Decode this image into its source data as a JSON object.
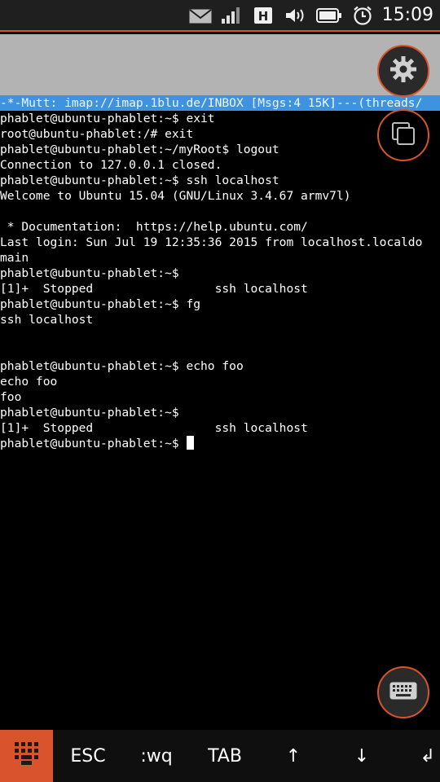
{
  "status_bar": {
    "time": "15:09",
    "icons": [
      "envelope-icon",
      "signal-icon",
      "hspa-icon",
      "volume-icon",
      "battery-icon",
      "alarm-icon"
    ],
    "network_label": "H"
  },
  "terminal": {
    "lines": [
      "-*-Mutt: imap://imap.1blu.de/INBOX [Msgs:4 15K]---(threads/",
      "phablet@ubuntu-phablet:~$ exit",
      "root@ubuntu-phablet:/# exit",
      "phablet@ubuntu-phablet:~/myRoot$ logout",
      "Connection to 127.0.0.1 closed.",
      "phablet@ubuntu-phablet:~$ ssh localhost",
      "Welcome to Ubuntu 15.04 (GNU/Linux 3.4.67 armv7l)",
      "",
      " * Documentation:  https://help.ubuntu.com/",
      "Last login: Sun Jul 19 12:35:36 2015 from localhost.localdo",
      "main",
      "phablet@ubuntu-phablet:~$",
      "[1]+  Stopped                 ssh localhost",
      "phablet@ubuntu-phablet:~$ fg",
      "ssh localhost",
      "",
      "",
      "phablet@ubuntu-phablet:~$ echo foo",
      "echo foo",
      "foo",
      "phablet@ubuntu-phablet:~$",
      "[1]+  Stopped                 ssh localhost",
      "phablet@ubuntu-phablet:~$ "
    ]
  },
  "buttons": {
    "settings": "gear-icon",
    "windows": "windows-icon",
    "keyboard": "keyboard-icon"
  },
  "keybar": {
    "menu_icon": "grid-icon",
    "keys": [
      "ESC",
      ":wq",
      "TAB",
      "↑",
      "↓",
      "↲"
    ]
  },
  "colors": {
    "accent": "#d9532c",
    "mutt_status_bg": "#3d93e0",
    "grey_area": "#b3b3b3",
    "statusbar_bg": "#1f1f1f"
  }
}
